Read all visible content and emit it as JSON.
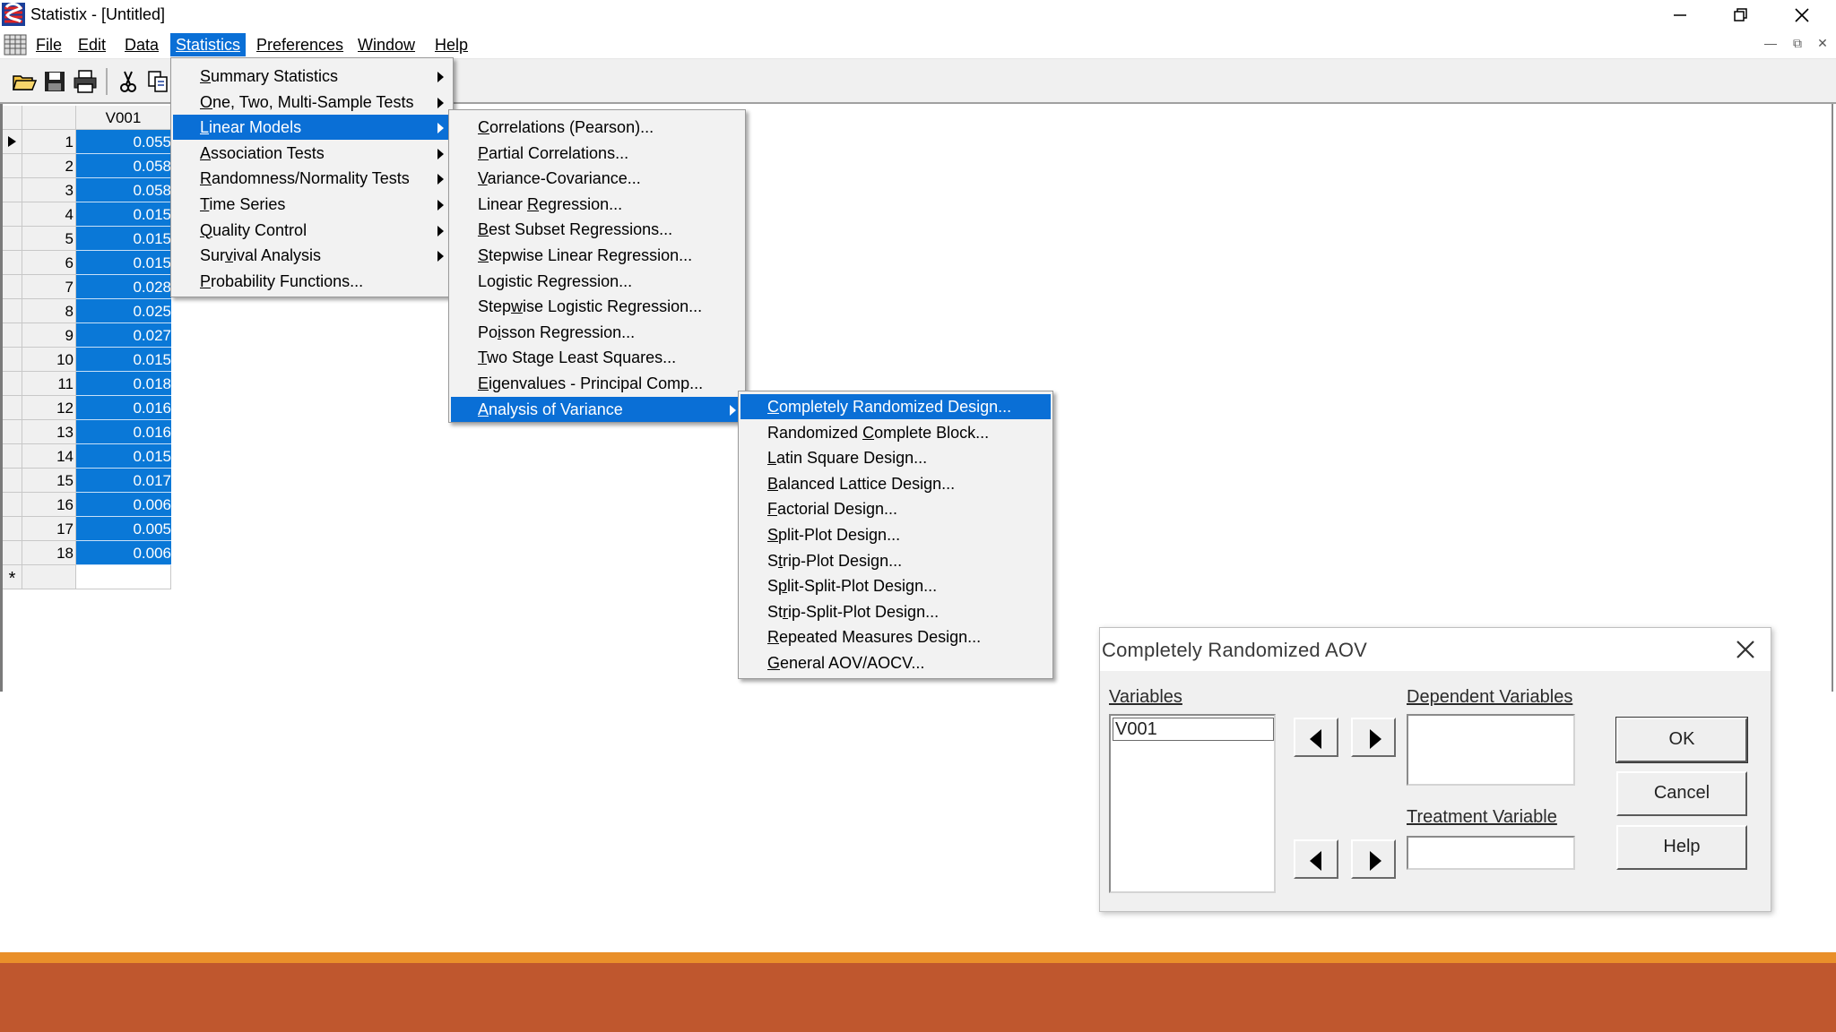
{
  "window": {
    "title": "Statistix - [Untitled]"
  },
  "menubar": {
    "items": [
      {
        "label": "File"
      },
      {
        "label": "Edit"
      },
      {
        "label": "Data"
      },
      {
        "label": "Statistics"
      },
      {
        "label": "Preferences"
      },
      {
        "label": "Window"
      },
      {
        "label": "Help"
      }
    ]
  },
  "sheet": {
    "column_header": "V001",
    "rows": [
      {
        "n": "1",
        "v": "0.055"
      },
      {
        "n": "2",
        "v": "0.058"
      },
      {
        "n": "3",
        "v": "0.058"
      },
      {
        "n": "4",
        "v": "0.015"
      },
      {
        "n": "5",
        "v": "0.015"
      },
      {
        "n": "6",
        "v": "0.015"
      },
      {
        "n": "7",
        "v": "0.028"
      },
      {
        "n": "8",
        "v": "0.025"
      },
      {
        "n": "9",
        "v": "0.027"
      },
      {
        "n": "10",
        "v": "0.015"
      },
      {
        "n": "11",
        "v": "0.018"
      },
      {
        "n": "12",
        "v": "0.016"
      },
      {
        "n": "13",
        "v": "0.016"
      },
      {
        "n": "14",
        "v": "0.015"
      },
      {
        "n": "15",
        "v": "0.017"
      },
      {
        "n": "16",
        "v": "0.006"
      },
      {
        "n": "17",
        "v": "0.005"
      },
      {
        "n": "18",
        "v": "0.006"
      }
    ],
    "new_row_marker": "*"
  },
  "statistics_menu": {
    "items": [
      {
        "label": "Summary Statistics",
        "u": "S",
        "rest": "ummary Statistics",
        "submenu": true
      },
      {
        "label": "One, Two, Multi-Sample Tests",
        "u": "O",
        "rest": "ne, Two, Multi-Sample Tests",
        "submenu": true
      },
      {
        "label": "Linear Models",
        "u": "L",
        "rest": "inear Models",
        "submenu": true
      },
      {
        "label": "Association Tests",
        "u": "A",
        "rest": "ssociation Tests",
        "submenu": true
      },
      {
        "label": "Randomness/Normality Tests",
        "u": "R",
        "rest": "andomness/Normality Tests",
        "submenu": true
      },
      {
        "label": "Time Series",
        "u": "T",
        "rest": "ime Series",
        "submenu": true
      },
      {
        "label": "Quality Control",
        "u": "Q",
        "rest": "uality Control",
        "submenu": true
      },
      {
        "label": "Survival Analysis",
        "u": "v",
        "pre": "Sur",
        "rest": "ival Analysis",
        "submenu": true
      },
      {
        "label": "Probability Functions...",
        "u": "P",
        "rest": "robability Functions...",
        "submenu": false
      }
    ]
  },
  "linear_models_menu": {
    "items": [
      {
        "label": "Correlations (Pearson)...",
        "pre": "",
        "u": "C",
        "rest": "orrelations (Pearson)..."
      },
      {
        "label": "Partial Correlations...",
        "pre": "",
        "u": "P",
        "rest": "artial Correlations..."
      },
      {
        "label": "Variance-Covariance...",
        "pre": "",
        "u": "V",
        "rest": "ariance-Covariance..."
      },
      {
        "label": "Linear Regression...",
        "pre": "Linear ",
        "u": "R",
        "rest": "egression..."
      },
      {
        "label": "Best Subset Regressions...",
        "pre": "",
        "u": "B",
        "rest": "est Subset Regressions..."
      },
      {
        "label": "Stepwise Linear Regression...",
        "pre": "",
        "u": "S",
        "rest": "tepwise Linear Regression..."
      },
      {
        "label": "Logistic Regression...",
        "pre": "Lo",
        "u": "g",
        "rest": "istic Regression..."
      },
      {
        "label": "Stepwise Logistic Regression...",
        "pre": "Step",
        "u": "w",
        "rest": "ise Logistic Regression..."
      },
      {
        "label": "Poisson Regression...",
        "pre": "Po",
        "u": "i",
        "rest": "sson Regression..."
      },
      {
        "label": "Two Stage Least Squares...",
        "pre": "",
        "u": "T",
        "rest": "wo Stage Least Squares..."
      },
      {
        "label": "Eigenvalues - Principal Comp...",
        "pre": "",
        "u": "E",
        "rest": "igenvalues - Principal Comp..."
      },
      {
        "label": "Analysis of Variance",
        "pre": "",
        "u": "A",
        "rest": "nalysis of Variance",
        "submenu": true
      }
    ]
  },
  "aov_menu": {
    "items": [
      {
        "label": "Completely Randomized Design...",
        "pre": "",
        "u": "C",
        "rest": "ompletely Randomized Design..."
      },
      {
        "label": "Randomized Complete Block...",
        "pre": "Randomized ",
        "u": "C",
        "rest": "omplete Block..."
      },
      {
        "label": "Latin Square Design...",
        "pre": "",
        "u": "L",
        "rest": "atin Square Design..."
      },
      {
        "label": "Balanced Lattice Design...",
        "pre": "",
        "u": "B",
        "rest": "alanced Lattice Design..."
      },
      {
        "label": "Factorial Design...",
        "pre": "",
        "u": "F",
        "rest": "actorial Design..."
      },
      {
        "label": "Split-Plot Design...",
        "pre": "",
        "u": "S",
        "rest": "plit-Plot Design..."
      },
      {
        "label": "Strip-Plot Design...",
        "pre": "S",
        "u": "t",
        "rest": "rip-Plot Design..."
      },
      {
        "label": "Split-Split-Plot Design...",
        "pre": "S",
        "u": "p",
        "rest": "lit-Split-Plot Design..."
      },
      {
        "label": "Strip-Split-Plot Design...",
        "pre": "St",
        "u": "r",
        "rest": "ip-Split-Plot Design..."
      },
      {
        "label": "Repeated Measures Design...",
        "pre": "",
        "u": "R",
        "rest": "epeated Measures Design..."
      },
      {
        "label": "General AOV/AOCV...",
        "pre": "",
        "u": "G",
        "rest": "eneral AOV/AOCV..."
      }
    ]
  },
  "dialog": {
    "title": "Completely Randomized AOV",
    "variables_label": "Variables",
    "variables": [
      "V001"
    ],
    "dependent_label": "Dependent Variables",
    "treatment_label": "Treatment Variable",
    "ok_label": "OK",
    "cancel_label": "Cancel",
    "help_label": "Help"
  },
  "colors": {
    "highlight": "#0a6fd6",
    "selection": "#0a78d7",
    "bottom_bar_thin": "#e98f2a",
    "bottom_bar_thick": "#bf572e"
  }
}
